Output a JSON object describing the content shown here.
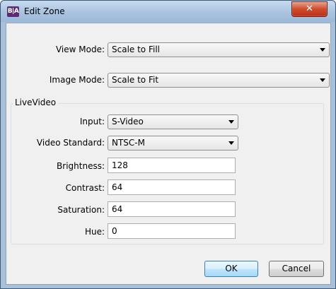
{
  "window": {
    "title": "Edit Zone",
    "icon_text": "B|A",
    "close_glyph": "✕"
  },
  "view_mode": {
    "label": "View Mode:",
    "value": "Scale to Fill"
  },
  "image_mode": {
    "label": "Image Mode:",
    "value": "Scale to Fit"
  },
  "live_video": {
    "group_title": "LiveVideo",
    "input": {
      "label": "Input:",
      "value": "S-Video"
    },
    "video_standard": {
      "label": "Video Standard:",
      "value": "NTSC-M"
    },
    "brightness": {
      "label": "Brightness:",
      "value": "128"
    },
    "contrast": {
      "label": "Contrast:",
      "value": "64"
    },
    "saturation": {
      "label": "Saturation:",
      "value": "64"
    },
    "hue": {
      "label": "Hue:",
      "value": "0"
    }
  },
  "buttons": {
    "ok": "OK",
    "cancel": "Cancel"
  }
}
